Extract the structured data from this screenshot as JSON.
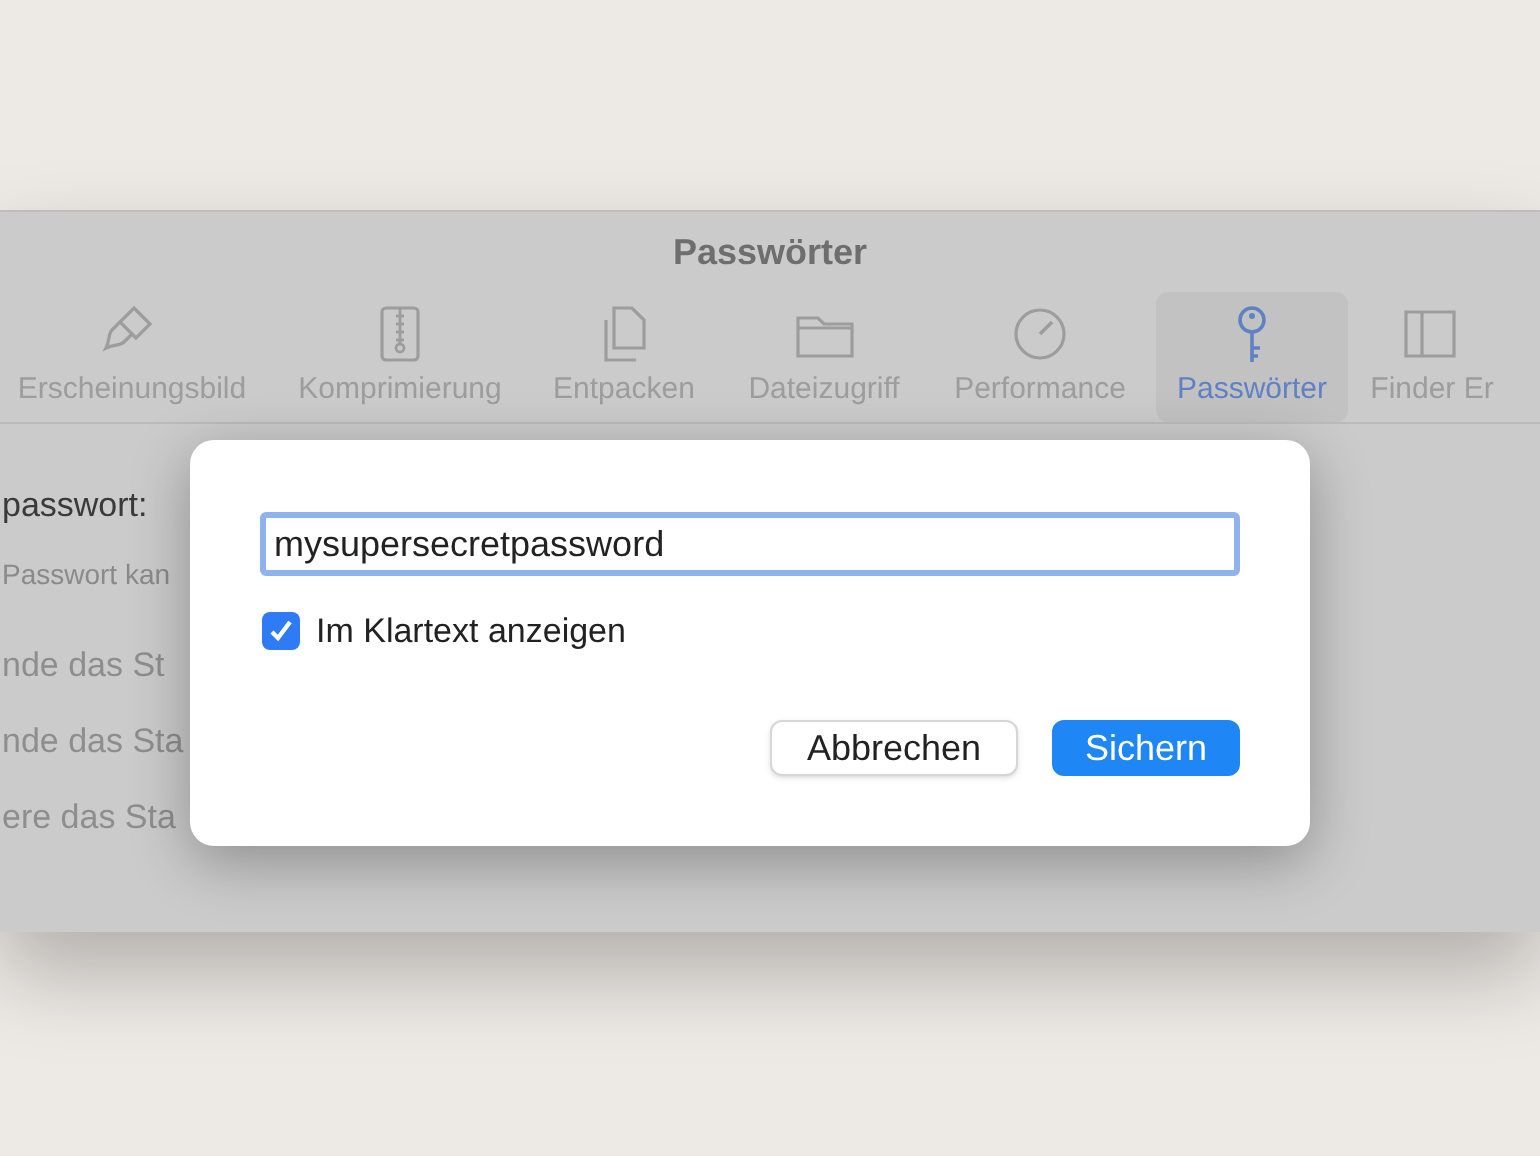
{
  "window": {
    "title": "Passwörter"
  },
  "toolbar": [
    {
      "label": "Erscheinungsbild",
      "selected": false
    },
    {
      "label": "Komprimierung",
      "selected": false
    },
    {
      "label": "Entpacken",
      "selected": false
    },
    {
      "label": "Dateizugriff",
      "selected": false
    },
    {
      "label": "Performance",
      "selected": false
    },
    {
      "label": "Passwörter",
      "selected": true
    },
    {
      "label": "Finder Er",
      "selected": false
    }
  ],
  "background_text": [
    {
      "kind": "label",
      "text": "passwort:"
    },
    {
      "kind": "note",
      "text": "Passwort kan"
    },
    {
      "kind": "option",
      "text": "nde das St"
    },
    {
      "kind": "option",
      "text": "nde das Sta"
    },
    {
      "kind": "option",
      "text": "ere das Sta"
    }
  ],
  "dialog": {
    "password": "mysupersecretpassword",
    "show_plain": {
      "label": "Im Klartext anzeigen",
      "checked": true
    },
    "buttons": [
      {
        "label": "Abbrechen",
        "kind": "secondary"
      },
      {
        "label": "Sichern",
        "kind": "primary"
      }
    ]
  }
}
